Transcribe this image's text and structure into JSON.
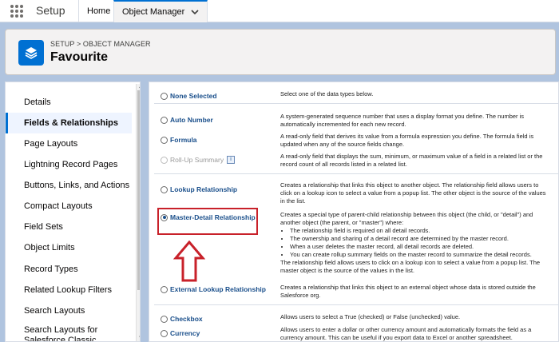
{
  "topnav": {
    "app_name": "Setup",
    "tabs": [
      {
        "label": "Home"
      },
      {
        "label": "Object Manager"
      }
    ]
  },
  "header": {
    "breadcrumb": "SETUP > OBJECT MANAGER",
    "title": "Favourite"
  },
  "sidebar": {
    "items": [
      {
        "label": "Details"
      },
      {
        "label": "Fields & Relationships",
        "active": true
      },
      {
        "label": "Page Layouts"
      },
      {
        "label": "Lightning Record Pages"
      },
      {
        "label": "Buttons, Links, and Actions"
      },
      {
        "label": "Compact Layouts"
      },
      {
        "label": "Field Sets"
      },
      {
        "label": "Object Limits"
      },
      {
        "label": "Record Types"
      },
      {
        "label": "Related Lookup Filters"
      },
      {
        "label": "Search Layouts"
      },
      {
        "label": "Search Layouts for Salesforce Classic"
      }
    ]
  },
  "field_types": [
    {
      "label": "None Selected",
      "desc": "Select one of the data types below."
    },
    {
      "label": "Auto Number",
      "desc": "A system-generated sequence number that uses a display format you define. The number is automatically incremented for each new record."
    },
    {
      "label": "Formula",
      "desc": "A read-only field that derives its value from a formula expression you define. The formula field is updated when any of the source fields change."
    },
    {
      "label": "Roll-Up Summary",
      "desc": "A read-only field that displays the sum, minimum, or maximum value of a field in a related list or the record count of all records listed in a related list."
    },
    {
      "label": "Lookup Relationship",
      "desc": "Creates a relationship that links this object to another object. The relationship field allows users to click on a lookup icon to select a value from a popup list. The other object is the source of the values in the list."
    },
    {
      "label": "Master-Detail Relationship",
      "desc": "Creates a special type of parent-child relationship between this object (the child, or \"detail\") and another object (the parent, or \"master\") where:",
      "bullets": [
        "The relationship field is required on all detail records.",
        "The ownership and sharing of a detail record are determined by the master record.",
        "When a user deletes the master record, all detail records are deleted.",
        "You can create rollup summary fields on the master record to summarize the detail records."
      ],
      "desc_after": "The relationship field allows users to click on a lookup icon to select a value from a popup list. The master object is the source of the values in the list."
    },
    {
      "label": "External Lookup Relationship",
      "desc": "Creates a relationship that links this object to an external object whose data is stored outside the Salesforce org."
    },
    {
      "label": "Checkbox",
      "desc": "Allows users to select a True (checked) or False (unchecked) value."
    },
    {
      "label": "Currency",
      "desc": "Allows users to enter a dollar or other currency amount and automatically formats the field as a currency amount. This can be useful if you export data to Excel or another spreadsheet."
    }
  ],
  "selected_type": "Master-Detail Relationship",
  "colors": {
    "accent": "#0070d2",
    "highlight": "#c8212a"
  }
}
